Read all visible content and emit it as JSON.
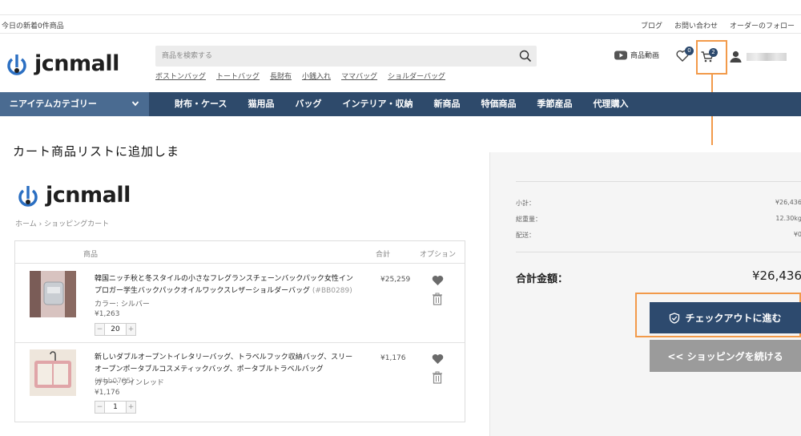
{
  "topbar": {
    "notice": "今日の新着0件商品",
    "links": [
      "ブログ",
      "お問い合わせ",
      "オーダーのフォロー"
    ]
  },
  "brand": {
    "name": "jcnmall",
    "color": "#2d4a6e"
  },
  "search": {
    "placeholder": "商品を検索する",
    "icon": "search-icon"
  },
  "quick_links": [
    "ボストンバッグ",
    "トートバッグ",
    "長財布",
    "小銭入れ",
    "ママバッグ",
    "ショルダーバッグ"
  ],
  "header_right": {
    "video_label": "商品動画",
    "wishlist_count": "0",
    "cart_count": "2",
    "icons": [
      "youtube-icon",
      "heart-icon",
      "cart-icon",
      "user-icon"
    ]
  },
  "nav": {
    "category_label": "ニアイテムカテゴリー",
    "items": [
      "財布・ケース",
      "猫用品",
      "バッグ",
      "インテリア・収納",
      "新商品",
      "特価商品",
      "季節産品",
      "代理購入"
    ]
  },
  "headline": "カート商品リストに追加しま",
  "breadcrumb": {
    "home": "ホーム",
    "current": "ショッピングカート"
  },
  "cart": {
    "headers": {
      "product": "商品",
      "total": "合計",
      "options": "オプション"
    },
    "items": [
      {
        "name": "韓国ニッチ秋と冬スタイルの小さなフレグランスチェーンバックパック女性インプロガー学生バックパックオイルワックスレザーショルダーバッグ",
        "code": "(#BB0289)",
        "color": "カラー: シルバー",
        "unit_price": "¥1,263",
        "qty": "20",
        "total": "¥25,259"
      },
      {
        "name": "新しいダブルオープントイレタリーバッグ、トラベルフック収納バッグ、スリーオープンポータブルコスメティックバッグ、ポータブルトラベルバッグ",
        "code": "(#bb0785)",
        "color": "カラー: ワインレッド",
        "unit_price": "¥1,176",
        "qty": "1",
        "total": "¥1,176"
      }
    ]
  },
  "summary": {
    "subtotal_label": "小計：",
    "subtotal": "¥26,436",
    "weight_label": "総重量：",
    "weight": "12.30kg",
    "shipping_label": "配送：",
    "shipping": "¥0",
    "total_label": "合計金額：",
    "total": "¥26,436"
  },
  "buttons": {
    "checkout": "チェックアウトに進む",
    "continue": "<< ショッピングを続ける"
  },
  "colors": {
    "nav": "#2e4a6b",
    "category": "#4a6b91",
    "annotation": "#f29a4a",
    "checkout": "#2d4a6e",
    "continue": "#9b9b9b"
  }
}
